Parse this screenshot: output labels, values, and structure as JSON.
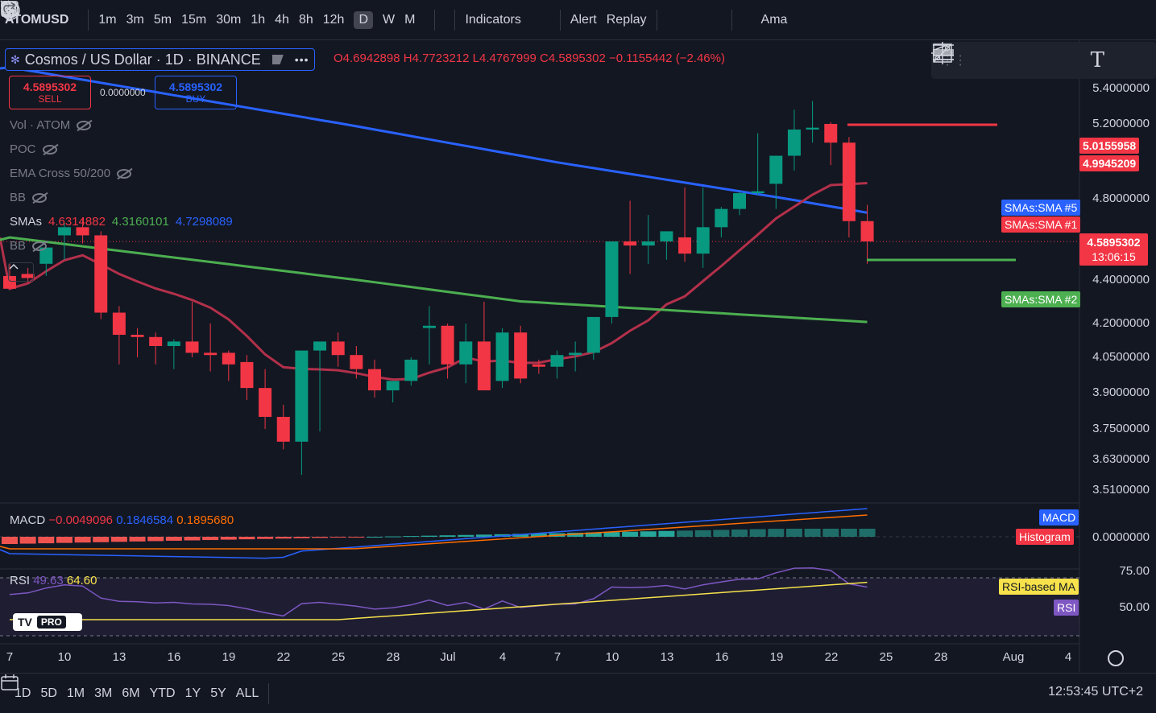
{
  "toolbar": {
    "symbol": "ATOMUSD",
    "add_symbol_icon": "plus-circle-icon",
    "timeframes": [
      "1m",
      "3m",
      "5m",
      "15m",
      "30m",
      "1h",
      "4h",
      "8h",
      "12h",
      "D",
      "W",
      "M"
    ],
    "active_timeframe": "D",
    "indicators_label": "Indicators",
    "alert_label": "Alert",
    "replay_label": "Replay",
    "right_label": "Ama"
  },
  "legend": {
    "title": "Cosmos / US Dollar · 1D · BINANCE",
    "ohlc_text": "O4.6942898 H4.7723212 L4.4767999 C4.5895302 −0.1155442 (−2.46%)"
  },
  "trade": {
    "sell_price": "4.5895302",
    "sell_label": "SELL",
    "spread": "0.0000000",
    "buy_price": "4.5895302",
    "buy_label": "BUY"
  },
  "indicators": {
    "vol": "Vol · ATOM",
    "poc": "POC",
    "ema": "EMA Cross 50/200",
    "bb": "BB",
    "smas_label": "SMAs",
    "sma1": "4.6314882",
    "sma2": "4.3160101",
    "sma3": "4.7298089",
    "bb2": "BB"
  },
  "price_axis": {
    "ticks": [
      "5.4000000",
      "5.2000000",
      "4.8000000",
      "4.4000000",
      "4.2000000",
      "4.0500000",
      "3.9000000",
      "3.7500000",
      "3.6300000",
      "3.5100000"
    ],
    "tag_high1": "5.0155958",
    "tag_high2": "4.9945209",
    "tag_sma5": "SMAs:SMA #5",
    "tag_sma1": "SMAs:SMA #1",
    "tag_price": "4.5895302",
    "tag_countdown": "13:06:15",
    "tag_sma2": "SMAs:SMA #2"
  },
  "macd": {
    "label": "MACD",
    "v1": "−0.0049096",
    "v2": "0.1846584",
    "v3": "0.1895680",
    "tag_macd": "MACD",
    "tag_hist": "Histogram",
    "zero": "0.0000000"
  },
  "rsi": {
    "label": "RSI",
    "v1": "49.63",
    "v2": "64.60",
    "tag_ma": "RSI-based MA",
    "tag_rsi": "RSI",
    "level75": "75.00",
    "level50": "50.00"
  },
  "logo": {
    "pro": "PRO"
  },
  "xaxis": [
    "7",
    "10",
    "13",
    "16",
    "19",
    "22",
    "25",
    "28",
    "Jul",
    "4",
    "7",
    "10",
    "13",
    "16",
    "19",
    "22",
    "25",
    "28",
    "Aug",
    "4"
  ],
  "ranges": [
    "1D",
    "5D",
    "1M",
    "3M",
    "6M",
    "YTD",
    "1Y",
    "5Y",
    "ALL"
  ],
  "clock": "12:53:45 UTC+2",
  "chart_data": {
    "type": "candlestick",
    "x": [
      "Jun 6",
      "Jun 7",
      "Jun 8",
      "Jun 9",
      "Jun 10",
      "Jun 11",
      "Jun 12",
      "Jun 13",
      "Jun 14",
      "Jun 15",
      "Jun 16",
      "Jun 17",
      "Jun 18",
      "Jun 19",
      "Jun 20",
      "Jun 21",
      "Jun 22",
      "Jun 23",
      "Jun 24",
      "Jun 25",
      "Jun 26",
      "Jun 27",
      "Jun 28",
      "Jun 29",
      "Jun 30",
      "Jul 1",
      "Jul 2",
      "Jul 3",
      "Jul 4",
      "Jul 5",
      "Jul 6",
      "Jul 7",
      "Jul 8",
      "Jul 9",
      "Jul 10",
      "Jul 11",
      "Jul 12",
      "Jul 13",
      "Jul 14",
      "Jul 15",
      "Jul 16",
      "Jul 17",
      "Jul 18",
      "Jul 19",
      "Jul 20",
      "Jul 21",
      "Jul 22",
      "Jul 23"
    ],
    "open": [
      4.42,
      4.43,
      4.48,
      4.62,
      4.66,
      4.62,
      4.25,
      4.15,
      4.14,
      4.1,
      4.12,
      4.07,
      4.07,
      4.03,
      3.92,
      3.8,
      3.7,
      4.08,
      4.12,
      4.06,
      4.0,
      3.91,
      3.95,
      4.18,
      4.19,
      4.02,
      4.12,
      3.95,
      4.16,
      4.02,
      4.01,
      4.06,
      4.07,
      4.23,
      4.59,
      4.57,
      4.59,
      4.61,
      4.53,
      4.66,
      4.75,
      4.83,
      4.88,
      5.03,
      5.17,
      5.2,
      5.1,
      4.69
    ],
    "high": [
      4.48,
      4.46,
      4.55,
      4.68,
      4.7,
      4.64,
      4.28,
      4.18,
      4.16,
      4.13,
      4.3,
      4.2,
      4.08,
      4.06,
      4.0,
      3.85,
      3.8,
      4.1,
      4.16,
      4.1,
      4.04,
      3.94,
      4.05,
      4.28,
      4.2,
      4.2,
      4.3,
      4.18,
      4.19,
      4.04,
      4.08,
      4.12,
      4.2,
      4.42,
      4.79,
      4.72,
      4.63,
      4.86,
      4.86,
      4.76,
      4.84,
      5.15,
      4.9,
      5.28,
      5.33,
      5.21,
      5.13,
      4.77
    ],
    "low": [
      4.36,
      4.39,
      4.42,
      4.5,
      4.58,
      4.22,
      4.02,
      4.05,
      4.02,
      4.0,
      4.05,
      3.99,
      3.95,
      3.87,
      3.75,
      3.67,
      3.57,
      3.74,
      4.01,
      3.96,
      3.88,
      3.86,
      3.93,
      4.02,
      3.96,
      3.94,
      4.03,
      3.92,
      3.94,
      3.98,
      3.96,
      3.99,
      4.04,
      4.2,
      4.43,
      4.48,
      4.5,
      4.49,
      4.46,
      4.61,
      4.72,
      4.82,
      4.75,
      4.95,
      5.1,
      4.98,
      4.61,
      4.48
    ],
    "close": [
      4.36,
      4.41,
      4.56,
      4.66,
      4.62,
      4.25,
      4.15,
      4.14,
      4.1,
      4.12,
      4.07,
      4.06,
      4.02,
      3.92,
      3.8,
      3.7,
      4.08,
      4.12,
      4.06,
      4.0,
      3.91,
      3.95,
      4.04,
      4.19,
      4.02,
      4.12,
      3.91,
      4.16,
      3.96,
      4.01,
      4.06,
      4.07,
      4.23,
      4.59,
      4.57,
      4.59,
      4.64,
      4.53,
      4.66,
      4.75,
      4.83,
      4.84,
      5.03,
      5.17,
      5.18,
      5.1,
      4.69,
      4.59
    ],
    "sma_series": [
      {
        "name": "SMAs:SMA #5",
        "color": "#2962ff"
      },
      {
        "name": "SMAs:SMA #1",
        "color": "#b2304a"
      },
      {
        "name": "SMAs:SMA #2",
        "color": "#4caf50"
      }
    ],
    "ylim": [
      3.51,
      5.4
    ],
    "last_price": 4.5895302
  },
  "colors": {
    "up": "#089981",
    "down": "#f23645",
    "sma_blue": "#2962ff",
    "sma_red": "#b2304a",
    "sma_green": "#4caf50"
  }
}
